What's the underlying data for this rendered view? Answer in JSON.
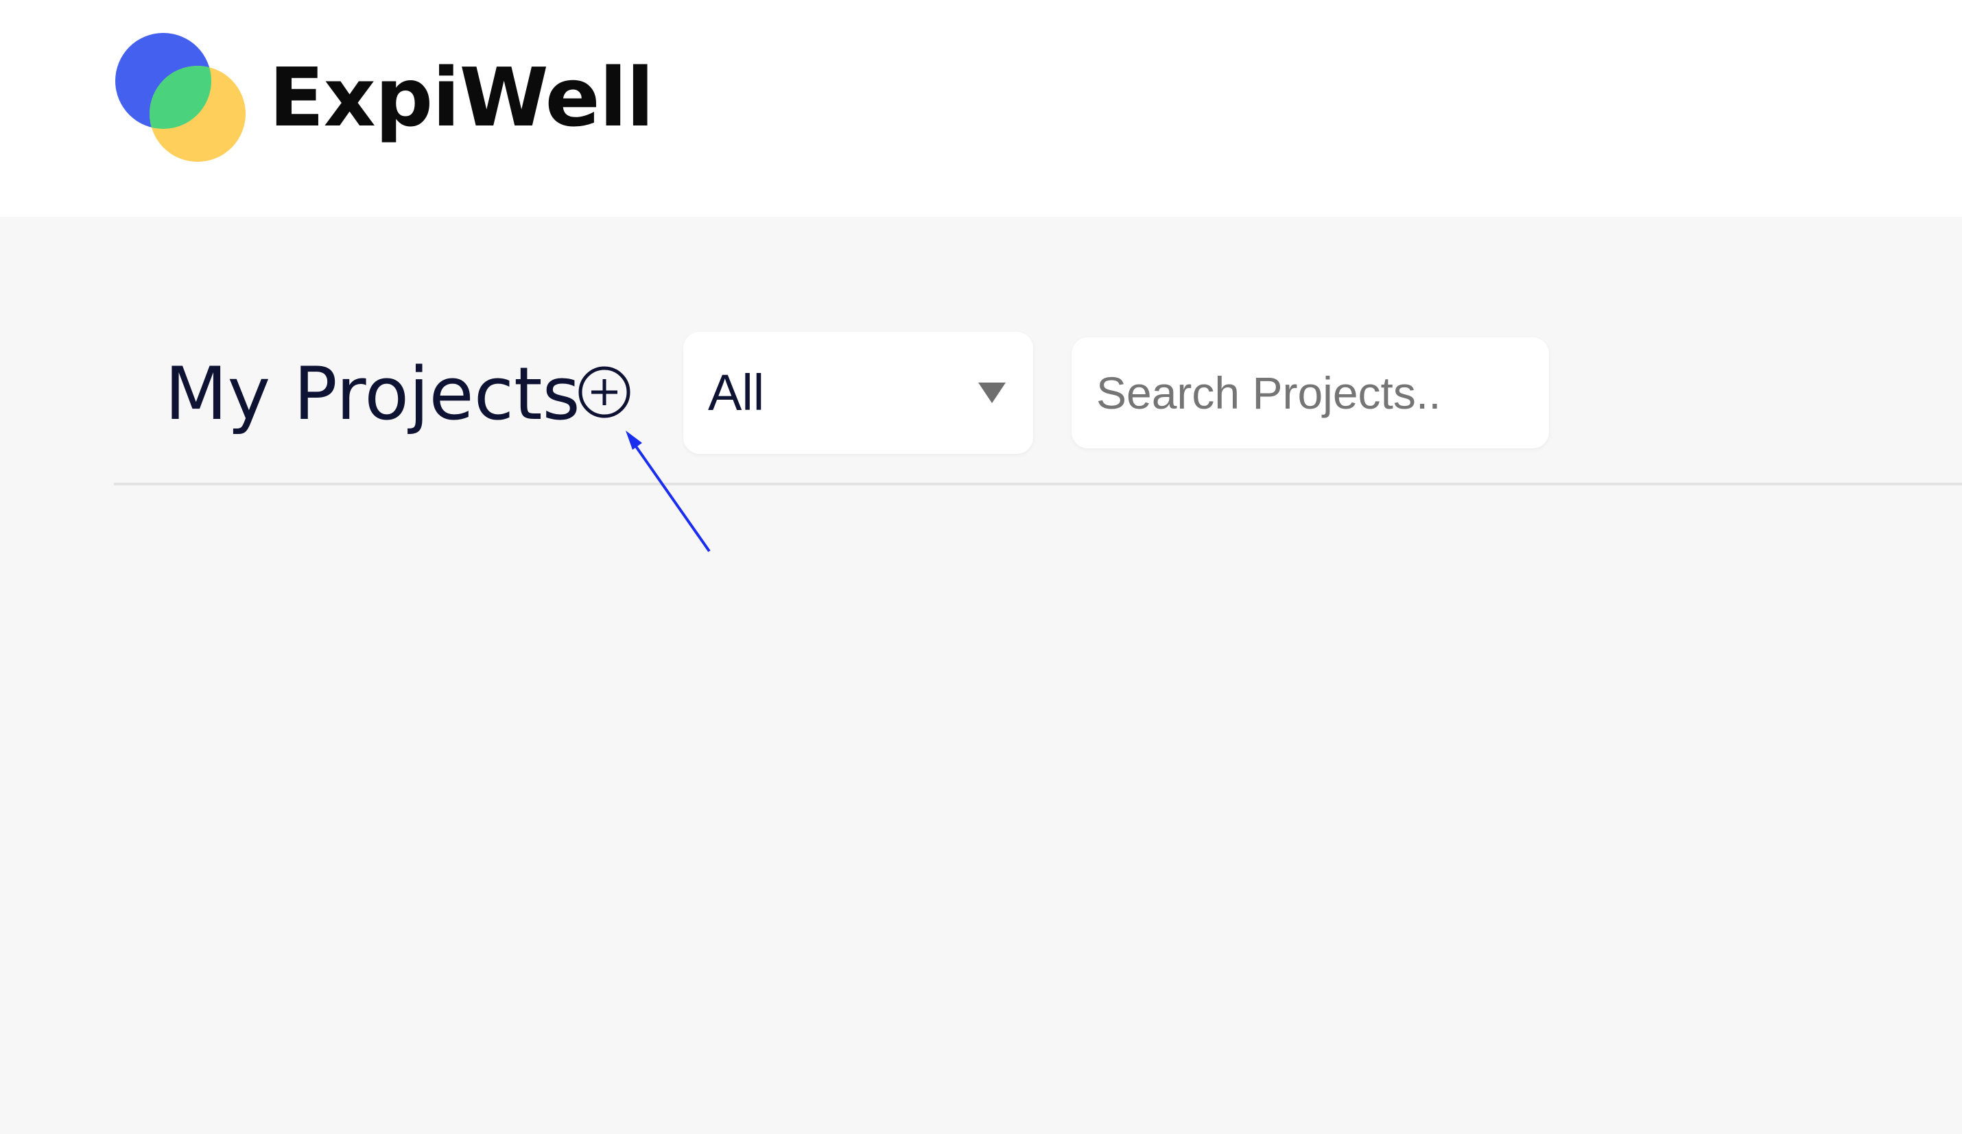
{
  "header": {
    "brand": "ExpiWell",
    "logo_colors": {
      "blue": "#4361ee",
      "green": "#4ad27c",
      "yellow": "#ffcf5c"
    }
  },
  "main": {
    "title": "My Projects",
    "add_icon": "plus-circle-icon",
    "filter": {
      "selected": "All",
      "icon": "caret-down-icon"
    },
    "search": {
      "placeholder": "Search Projects..",
      "value": ""
    }
  },
  "annotation": {
    "type": "arrow",
    "color": "#1a2ef0",
    "points_to": "add-project-button"
  }
}
